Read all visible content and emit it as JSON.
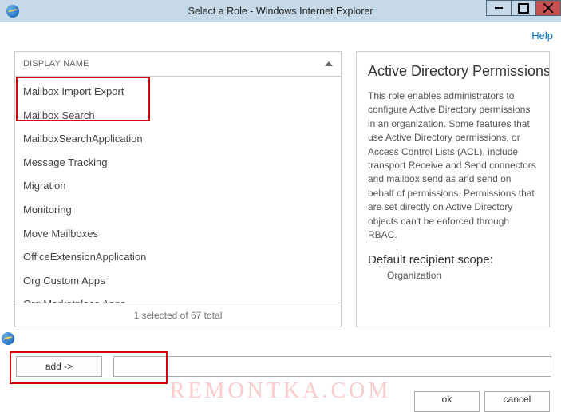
{
  "window": {
    "title": "Select a Role - Windows Internet Explorer",
    "help_label": "Help"
  },
  "list": {
    "header": "DISPLAY NAME",
    "status": "1 selected of 67 total",
    "items": [
      "Mailbox Import Export",
      "Mailbox Search",
      "MailboxSearchApplication",
      "Message Tracking",
      "Migration",
      "Monitoring",
      "Move Mailboxes",
      "OfficeExtensionApplication",
      "Org Custom Apps",
      "Org Marketplace Apps"
    ]
  },
  "details": {
    "title": "Active Directory Permissions",
    "body": "This role enables administrators to configure Active Directory permissions in an organization. Some features that use Active Directory permissions, or Access Control Lists (ACL), include transport Receive and Send connectors and mailbox send as and send on behalf of permissions. Permissions that are set directly on Active Directory objects can't be enforced through RBAC.",
    "scope_label": "Default recipient scope:",
    "scope_value": "Organization"
  },
  "actions": {
    "add_label": "add ->",
    "ok_label": "ok",
    "cancel_label": "cancel"
  },
  "watermark": "REMONTKA.COM"
}
